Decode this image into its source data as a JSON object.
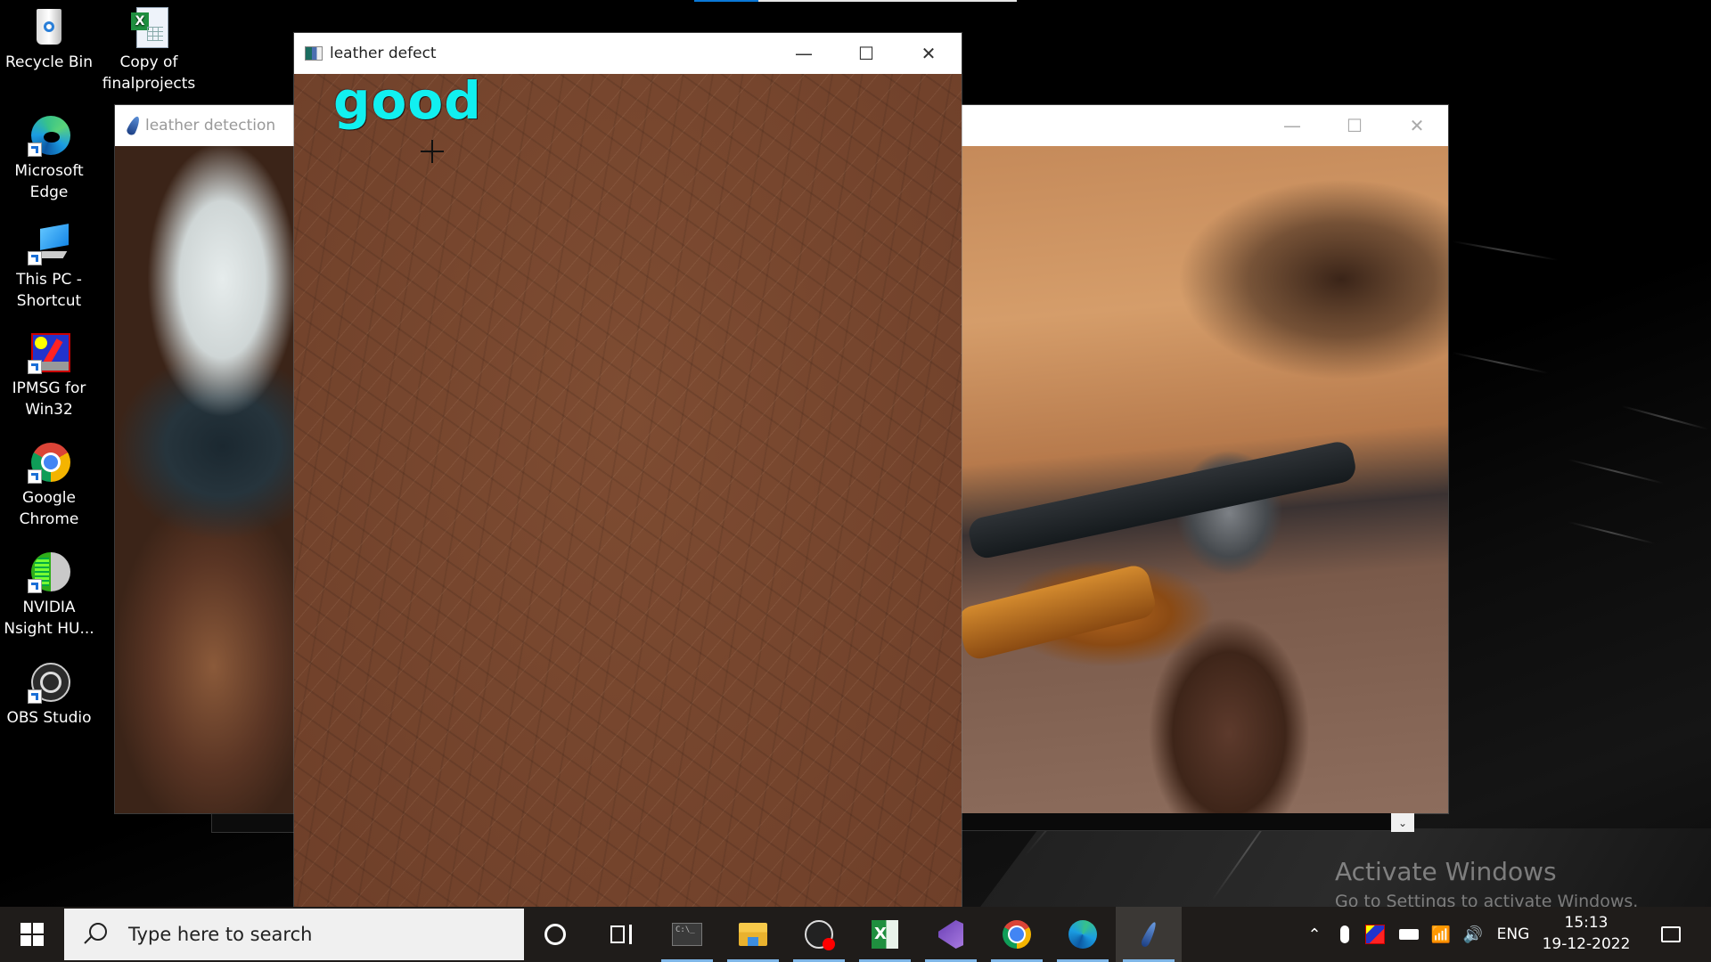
{
  "top_progress": {
    "value_percent": 20,
    "fill_color": "#0a78d7"
  },
  "desktop": {
    "icons": [
      {
        "label": "Recycle Bin",
        "icon": "recycle-bin-icon"
      },
      {
        "label": "Copy of finalprojects",
        "icon": "excel-file-icon"
      },
      {
        "label": "Microsoft Edge",
        "icon": "edge-icon"
      },
      {
        "label": "This PC - Shortcut",
        "icon": "computer-icon"
      },
      {
        "label": "IPMSG for Win32",
        "icon": "ipmsg-icon"
      },
      {
        "label": "Google Chrome",
        "icon": "chrome-icon"
      },
      {
        "label": "NVIDIA Nsight HU...",
        "icon": "nvidia-nsight-icon"
      },
      {
        "label": "OBS Studio",
        "icon": "obs-icon"
      }
    ]
  },
  "windows": {
    "detection": {
      "title": "leather detection",
      "icon": "feather-icon"
    },
    "defect": {
      "title": "leather defect",
      "icon": "app-window-icon",
      "result_label": "good",
      "result_color": "#11f0f0"
    },
    "controls": {
      "minimize": "—",
      "maximize": "☐",
      "close": "✕"
    }
  },
  "watermark": {
    "title": "Activate Windows",
    "subtitle": "Go to Settings to activate Windows."
  },
  "taskbar": {
    "search_placeholder": "Type here to search",
    "apps": [
      {
        "name": "cortana",
        "icon": "cortana-icon"
      },
      {
        "name": "task-view",
        "icon": "task-view-icon"
      },
      {
        "name": "command-prompt",
        "icon": "cmd-icon"
      },
      {
        "name": "file-explorer",
        "icon": "folder-icon"
      },
      {
        "name": "obs-studio",
        "icon": "obs-icon"
      },
      {
        "name": "excel",
        "icon": "excel-icon"
      },
      {
        "name": "visual-studio",
        "icon": "visual-studio-icon"
      },
      {
        "name": "google-chrome",
        "icon": "chrome-icon"
      },
      {
        "name": "microsoft-edge",
        "icon": "edge-icon"
      },
      {
        "name": "python-idle",
        "icon": "feather-icon"
      }
    ],
    "tray": {
      "language": "ENG",
      "time": "15:13",
      "date": "19-12-2022"
    }
  }
}
